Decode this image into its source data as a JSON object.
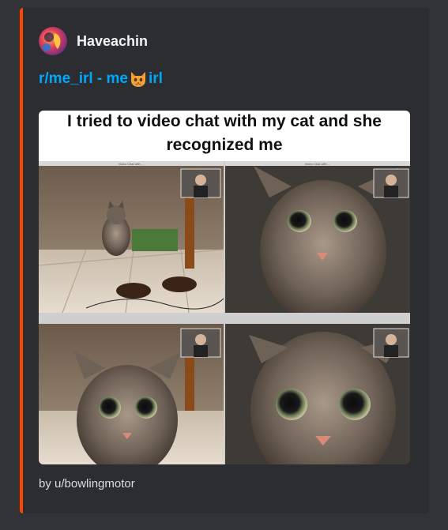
{
  "embed": {
    "accent_color": "#ff4500",
    "author": {
      "name": "Haveachin",
      "avatar_icon": "user-avatar"
    },
    "title": {
      "prefix": "r/me_irl - me",
      "emoji": "cat-face-emoji",
      "suffix": "irl"
    },
    "image": {
      "caption_line1": "I tried to video chat with my cat and she",
      "caption_line2": "recognized me",
      "panel_caption": "Video Chat with ..."
    },
    "footer": "by u/bowlingmotor"
  }
}
